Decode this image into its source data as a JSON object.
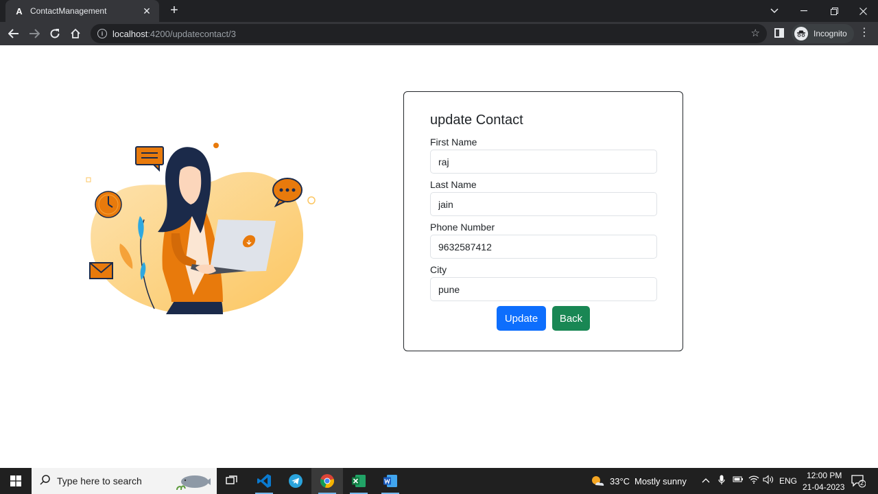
{
  "browser": {
    "tab_title": "ContactManagement",
    "tab_favicon": "A",
    "tab_close": "✕",
    "new_tab": "+",
    "url_host": "localhost",
    "url_path": ":4200/updatecontact/3",
    "incognito_label": "Incognito"
  },
  "form": {
    "title": "update Contact",
    "fields": [
      {
        "label": "First Name",
        "value": "raj"
      },
      {
        "label": "Last Name",
        "value": "jain"
      },
      {
        "label": "Phone Number",
        "value": "9632587412"
      },
      {
        "label": "City",
        "value": "pune"
      }
    ],
    "update_label": "Update",
    "back_label": "Back"
  },
  "taskbar": {
    "search_placeholder": "Type here to search",
    "weather_temp": "33°C",
    "weather_text": "Mostly sunny",
    "language": "ENG",
    "time": "12:00 PM",
    "date": "21-04-2023",
    "notification_count": "2"
  },
  "colors": {
    "primary": "#0d6efd",
    "success": "#198754",
    "illustration_orange": "#e87a0c",
    "illustration_blob": "#fdd48a"
  }
}
